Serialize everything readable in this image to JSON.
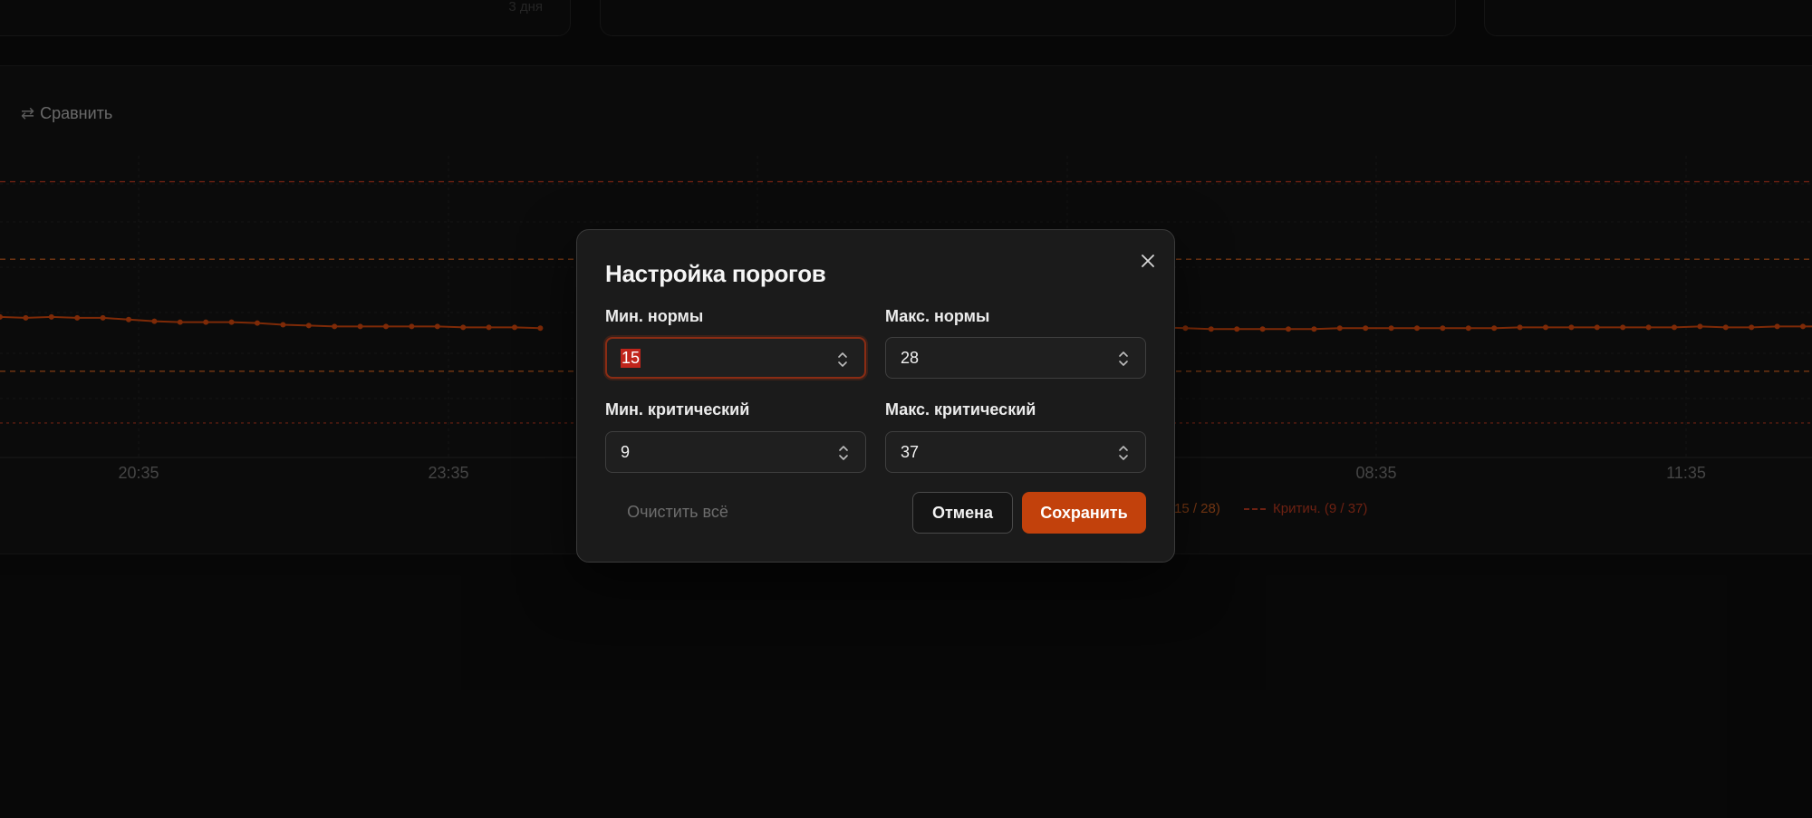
{
  "background": {
    "top_card_hint": "3 дня",
    "compare_label": "Сравнить",
    "legend": {
      "norm_label": "15 / 28)",
      "critical_label": "Критич. (9 / 37)"
    },
    "colors": {
      "series": "#c2410c",
      "norm_line": "#b8561e",
      "critical_line": "#a8331c"
    }
  },
  "chart_data": {
    "type": "line",
    "x_ticks": [
      "20:35",
      "23:35",
      "08:35",
      "11:35"
    ],
    "thresholds": {
      "min_norm": 15,
      "max_norm": 28,
      "min_critical": 9,
      "max_critical": 37
    },
    "series": [
      {
        "values": [
          21.3,
          21.2,
          21.3,
          21.2,
          21.2,
          21.0,
          20.8,
          20.7,
          20.7,
          20.7,
          20.6,
          20.4,
          20.3,
          20.2,
          20.2,
          20.2,
          20.2,
          20.2,
          20.1,
          20.1,
          20.1,
          20.0
        ],
        "segment": "left"
      },
      {
        "values": [
          20.1,
          20.0,
          19.9,
          19.9,
          19.9,
          19.9,
          19.9,
          20.0,
          20.0,
          20.0,
          20.0,
          20.0,
          20.0,
          20.0,
          20.1,
          20.1,
          20.1,
          20.1,
          20.1,
          20.1,
          20.1,
          20.2,
          20.1,
          20.1,
          20.2,
          20.2,
          20.2,
          20.2,
          20.2,
          20.2,
          20.2,
          20.3
        ],
        "segment": "right"
      }
    ]
  },
  "modal": {
    "title": "Настройка порогов",
    "min_norm": {
      "label": "Мин. нормы",
      "value": "15"
    },
    "max_norm": {
      "label": "Макс. нормы",
      "value": "28"
    },
    "min_critical": {
      "label": "Мин. критический",
      "value": "9"
    },
    "max_critical": {
      "label": "Макс. критический",
      "value": "37"
    },
    "clear_label": "Очистить всё",
    "cancel_label": "Отмена",
    "save_label": "Сохранить",
    "icons": {
      "close": "close-icon",
      "stepper": "chevron-up-down-icon",
      "compare": "swap-arrows-icon"
    }
  }
}
